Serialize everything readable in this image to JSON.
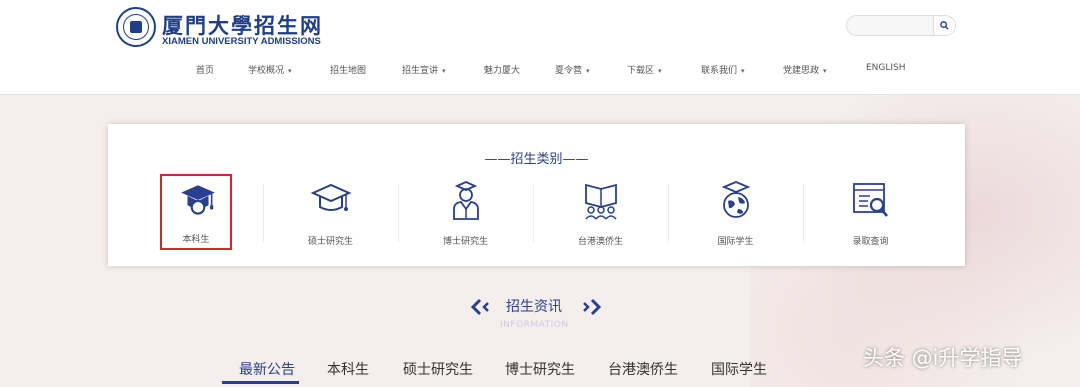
{
  "header": {
    "logo_cn": "厦門大學招生网",
    "logo_en": "XIAMEN UNIVERSITY ADMISSIONS",
    "search": {
      "placeholder": "",
      "value": ""
    },
    "nav": [
      {
        "label": "首页",
        "dropdown": false
      },
      {
        "label": "学校概况",
        "dropdown": true
      },
      {
        "label": "招生地图",
        "dropdown": false
      },
      {
        "label": "招生宣讲",
        "dropdown": true
      },
      {
        "label": "魅力厦大",
        "dropdown": false
      },
      {
        "label": "夏令营",
        "dropdown": true
      },
      {
        "label": "下载区",
        "dropdown": true
      },
      {
        "label": "联系我们",
        "dropdown": true
      },
      {
        "label": "党建思政",
        "dropdown": true
      },
      {
        "label": "ENGLISH",
        "dropdown": false
      }
    ]
  },
  "categories": {
    "title": "——招生类别——",
    "items": [
      {
        "label": "本科生",
        "icon": "undergraduate-icon",
        "selected": true
      },
      {
        "label": "硕士研究生",
        "icon": "graduation-cap-icon",
        "selected": false
      },
      {
        "label": "博士研究生",
        "icon": "doctor-icon",
        "selected": false
      },
      {
        "label": "台港澳侨生",
        "icon": "students-book-icon",
        "selected": false
      },
      {
        "label": "国际学生",
        "icon": "globe-cap-icon",
        "selected": false
      },
      {
        "label": "录取查询",
        "icon": "search-document-icon",
        "selected": false
      }
    ],
    "accent_color": "#2a3f8f",
    "highlight_color": "#d9232d"
  },
  "info": {
    "title": "招生资讯",
    "subtitle": "INFORMATION",
    "tabs": [
      {
        "label": "最新公告",
        "active": true
      },
      {
        "label": "本科生",
        "active": false
      },
      {
        "label": "硕士研究生",
        "active": false
      },
      {
        "label": "博士研究生",
        "active": false
      },
      {
        "label": "台港澳侨生",
        "active": false
      },
      {
        "label": "国际学生",
        "active": false
      }
    ]
  },
  "watermark": "头条 @i升学指导"
}
